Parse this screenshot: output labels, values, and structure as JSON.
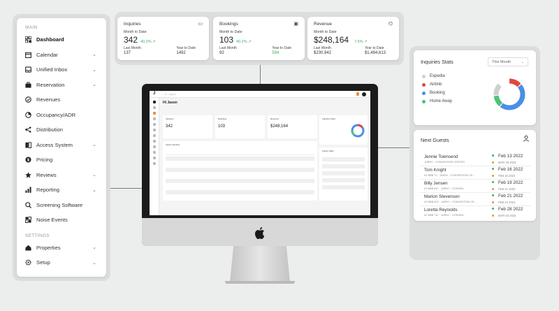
{
  "sidebar": {
    "section_main": "MAIN",
    "section_settings": "SETTINGS",
    "items": [
      {
        "label": "Dashboard",
        "icon": "grid-icon",
        "active": true
      },
      {
        "label": "Calendar",
        "icon": "calendar-icon"
      },
      {
        "label": "Unified Inbox",
        "icon": "inbox-icon"
      },
      {
        "label": "Reservation",
        "icon": "briefcase-icon"
      },
      {
        "label": "Revenues",
        "icon": "revenue-icon"
      },
      {
        "label": "Occupancy/ADR",
        "icon": "occupancy-icon"
      },
      {
        "label": "Distribution",
        "icon": "distribution-icon"
      },
      {
        "label": "Access System",
        "icon": "access-icon"
      },
      {
        "label": "Pricing",
        "icon": "pricing-icon"
      },
      {
        "label": "Reviews",
        "icon": "star-icon"
      },
      {
        "label": "Reporting",
        "icon": "bar-chart-icon"
      },
      {
        "label": "Screening Software",
        "icon": "search-icon"
      },
      {
        "label": "Noise Events",
        "icon": "noise-icon"
      }
    ],
    "settings_items": [
      {
        "label": "Properties",
        "icon": "home-icon"
      },
      {
        "label": "Setup",
        "icon": "gear-icon"
      }
    ]
  },
  "stats": [
    {
      "title": "Inquiries",
      "icon": "chat-icon",
      "mtd_label": "Month to Date",
      "mtd_value": "342",
      "pct": "40.2% ↗",
      "last_label": "Last Month",
      "last_value": "137",
      "ytd_label": "Year to Date",
      "ytd_value": "1492",
      "ytd_green": false
    },
    {
      "title": "Bookings",
      "icon": "briefcase-icon",
      "mtd_label": "Month to Date",
      "mtd_value": "103",
      "pct": "40.2% ↗",
      "last_label": "Last Month",
      "last_value": "92",
      "ytd_label": "Year to Date",
      "ytd_value": "594",
      "ytd_green": true
    },
    {
      "title": "Revenue",
      "icon": "tag-icon",
      "mtd_label": "Month to Date",
      "mtd_value": "$248,164",
      "pct": "7.5% ↗",
      "last_label": "Last Month",
      "last_value": "$230,942",
      "ytd_label": "Year to Date",
      "ytd_value": "$1,484,613",
      "ytd_green": false
    }
  ],
  "inquiries_stats": {
    "title": "Inquiries Stats",
    "period": "This Month",
    "legend": [
      {
        "label": "Expedia",
        "color": "#cfcfcf"
      },
      {
        "label": "Airbnb",
        "color": "#e0473f"
      },
      {
        "label": "Booking",
        "color": "#4a8ee8"
      },
      {
        "label": "Home Away",
        "color": "#52c07a"
      }
    ],
    "shares": [
      0.14,
      0.14,
      0.47,
      0.13
    ]
  },
  "next_guests": {
    "title": "Next Guests",
    "guests": [
      {
        "name": "Jennie Townsend",
        "sub": "JURNY - CONVENTION CENTER",
        "date1": "Feb 13 2022",
        "date2": "MAR 29 2022"
      },
      {
        "name": "Tom Knight",
        "sub": "AT BBB 71 · JURNY - CONVENTION CE...",
        "date1": "Feb 16 2022",
        "date2": "FEB 18 2022"
      },
      {
        "name": "Billy Jensen",
        "sub": "AT BBB 812 · JURNY - CONVEN...",
        "date1": "Feb 19 2022",
        "date2": "FEB 21 2022"
      },
      {
        "name": "Marion Stevenson",
        "sub": "AT BBB 813 · JURNY - CONVENTION CE...",
        "date1": "Feb 21 2022",
        "date2": "FEB 24 2022"
      },
      {
        "name": "Loretta Reynolds",
        "sub": "AT BBB 712 · JURNY - CONVEN...",
        "date1": "Feb 28 2022",
        "date2": "MAR 03 2022"
      }
    ]
  },
  "imac_screen": {
    "logo": "J",
    "search": "Search",
    "greeting": "Hi Jason",
    "cards": [
      {
        "title": "Inquiries",
        "value": "342"
      },
      {
        "title": "Bookings",
        "value": "103"
      },
      {
        "title": "Revenue",
        "value": "$248,164"
      }
    ],
    "side_stats_title": "Inquiries Stats",
    "latest_inquiries_title": "Latest Inquiries",
    "next_guests_title": "Inquiry Stats"
  }
}
